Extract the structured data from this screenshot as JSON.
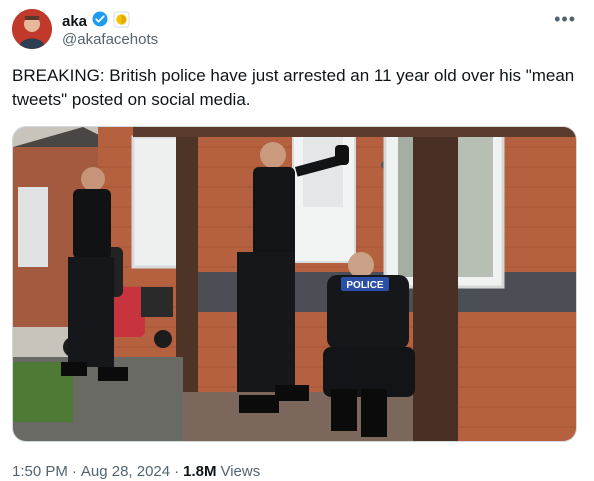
{
  "author": {
    "display_name": "aka",
    "handle": "@akafacehots",
    "verified_badge_color": "#1d9bf0",
    "affiliate_badge_color": "#f4c300"
  },
  "tweet": {
    "text": "BREAKING: British police have just arrested an 11 year old over his \"mean\ntweets\" posted on social media."
  },
  "media": {
    "vest_label": "POLICE"
  },
  "meta": {
    "time": "1:50 PM",
    "sep1": "·",
    "date": "Aug 28, 2024",
    "sep2": "·",
    "views_count": "1.8M",
    "views_label": "Views"
  },
  "icons": {
    "more": "more-icon",
    "verified": "verified-badge-icon",
    "affiliate": "affiliate-badge-icon"
  }
}
